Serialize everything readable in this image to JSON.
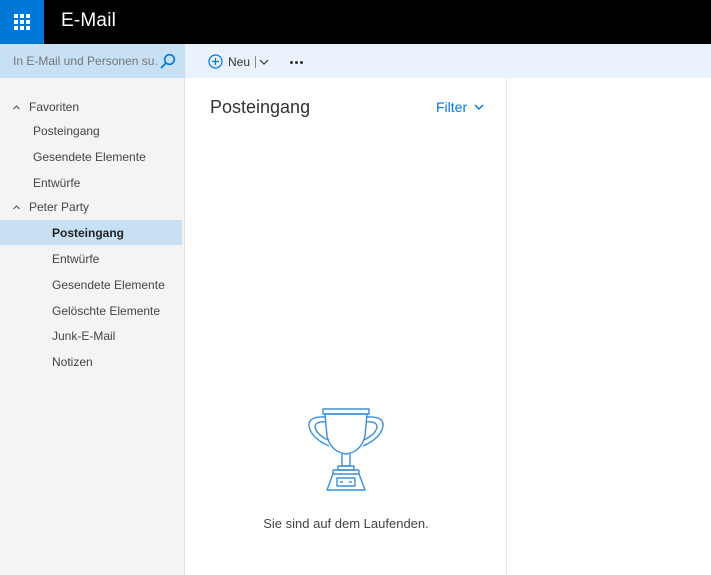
{
  "app": {
    "title": "E-Mail",
    "accent_color": "#0078d7",
    "launcher_icon": "waffle-icon"
  },
  "search": {
    "placeholder": "In E-Mail und Personen su…",
    "icon": "search-icon"
  },
  "commands": {
    "new_label": "Neu",
    "new_icon": "plus-circle-icon",
    "more_icon": "more-icon"
  },
  "nav": {
    "favorites": {
      "label": "Favoriten",
      "items": [
        "Posteingang",
        "Gesendete Elemente",
        "Entwürfe"
      ]
    },
    "account": {
      "label": "Peter Party",
      "items": [
        "Posteingang",
        "Entwürfe",
        "Gesendete Elemente",
        "Gelöschte Elemente",
        "Junk-E-Mail",
        "Notizen"
      ],
      "selected": "Posteingang"
    },
    "selected_color": "#c7e0f4"
  },
  "message_list": {
    "title": "Posteingang",
    "filter_label": "Filter",
    "empty_text": "Sie sind auf dem Laufenden.",
    "empty_icon": "trophy-icon"
  }
}
